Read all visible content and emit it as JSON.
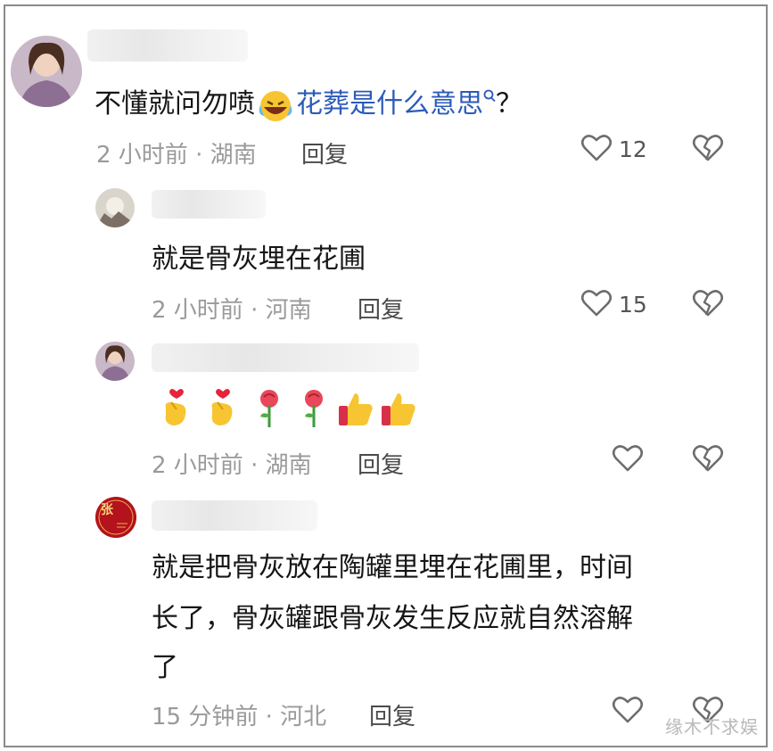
{
  "comments": [
    {
      "text_plain": "不懂就问勿喷",
      "text_link": "花葬是什么意思",
      "text_tail": "？",
      "time": "2 小时前 · 湖南",
      "reply": "回复",
      "likes": "12",
      "avatar_icon": "woman-avatar-icon"
    },
    {
      "text": "就是骨灰埋在花圃",
      "time": "2 小时前 · 河南",
      "reply": "回复",
      "likes": "15",
      "avatar_icon": "landscape-avatar-icon"
    },
    {
      "emojis": [
        "finger-heart-emoji",
        "finger-heart-emoji",
        "rose-emoji",
        "rose-emoji",
        "thumbs-up-emoji",
        "thumbs-up-emoji"
      ],
      "time": "2 小时前 · 湖南",
      "reply": "回复",
      "avatar_icon": "woman-avatar-icon"
    },
    {
      "text_lines": [
        "就是把骨灰放在陶罐里埋在花圃里，时间",
        "长了，骨灰罐跟骨灰发生反应就自然溶解",
        "了"
      ],
      "time": "15 分钟前 · 河北",
      "reply": "回复",
      "avatar_text": "张",
      "avatar_icon": "red-seal-avatar-icon"
    }
  ],
  "watermark": "缘木不求娱",
  "colors": {
    "link": "#2c5bb8",
    "meta": "#9a9a9a",
    "border": "#8a8a8a"
  }
}
